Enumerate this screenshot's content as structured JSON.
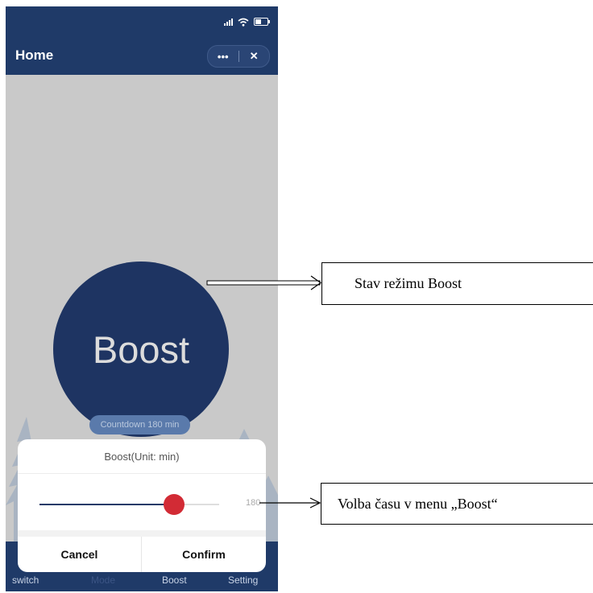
{
  "header": {
    "title": "Home",
    "menu_glyph": "•••",
    "close_glyph": "✕"
  },
  "main": {
    "mode_label": "Boost",
    "countdown_text": "Countdown 180 min"
  },
  "boost_sheet": {
    "title": "Boost(Unit: min)",
    "slider_value": "180",
    "slider_fraction": 0.75,
    "cancel_label": "Cancel",
    "confirm_label": "Confirm"
  },
  "tabbar": {
    "items": [
      {
        "label": "switch"
      },
      {
        "label": "Mode"
      },
      {
        "label": "Boost"
      },
      {
        "label": "Setting"
      }
    ]
  },
  "annotations": {
    "boost_state": "Stav režimu Boost",
    "time_selection": "Volba času v menu „Boost“"
  },
  "colors": {
    "accent": "#1f3a68",
    "thumb": "#d22b35",
    "circle": "#1e3462"
  },
  "icons": [
    "signal-icon",
    "wifi-icon",
    "battery-icon",
    "more-icon",
    "close-icon"
  ]
}
